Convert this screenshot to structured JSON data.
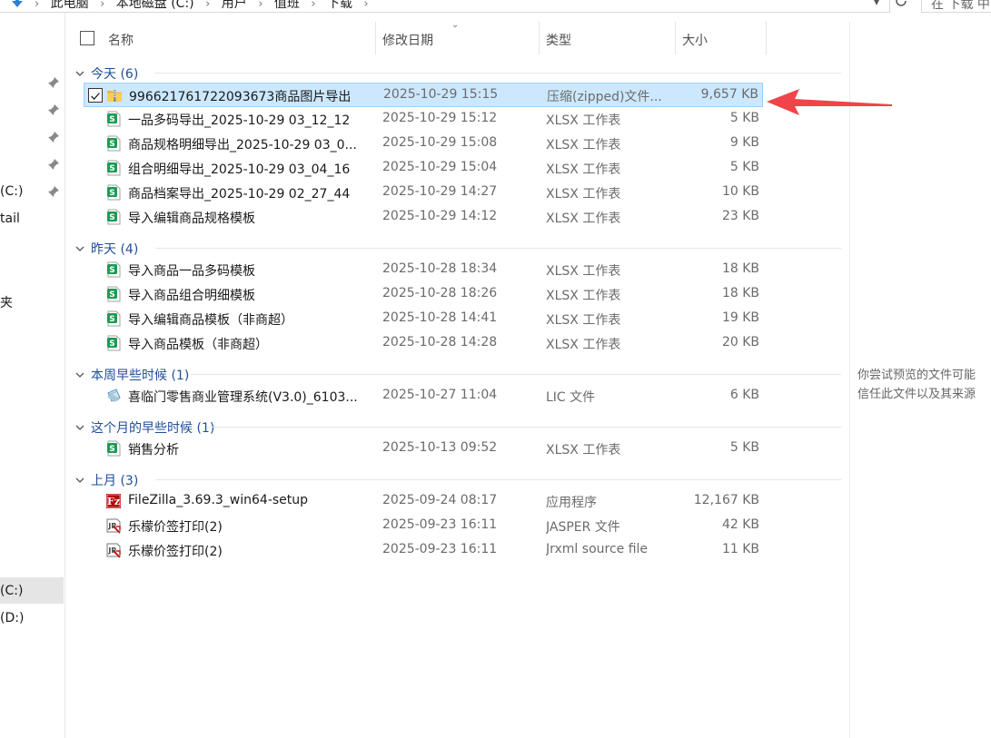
{
  "address_bar": {
    "crumbs": [
      "此电脑",
      "本地磁盘 (C:)",
      "用户",
      "值班",
      "下载"
    ],
    "search_placeholder": "在 下载 中"
  },
  "nav_pane": {
    "labels": [
      "(C:)",
      "tail",
      "夹",
      "(C:)",
      "(D:)"
    ]
  },
  "columns": {
    "name": "名称",
    "date": "修改日期",
    "type": "类型",
    "size": "大小"
  },
  "groups": [
    {
      "title": "今天 (6)",
      "files": [
        {
          "name": "996621761722093673商品图片导出",
          "date": "2025-10-29 15:15",
          "type": "压缩(zipped)文件...",
          "size": "9,657 KB",
          "icon": "zip-folder-icon",
          "selected": true
        },
        {
          "name": "一品多码导出_2025-10-29 03_12_12",
          "date": "2025-10-29 15:12",
          "type": "XLSX 工作表",
          "size": "5 KB",
          "icon": "xlsx-icon"
        },
        {
          "name": "商品规格明细导出_2025-10-29 03_0...",
          "date": "2025-10-29 15:08",
          "type": "XLSX 工作表",
          "size": "9 KB",
          "icon": "xlsx-icon"
        },
        {
          "name": "组合明细导出_2025-10-29 03_04_16",
          "date": "2025-10-29 15:04",
          "type": "XLSX 工作表",
          "size": "5 KB",
          "icon": "xlsx-icon"
        },
        {
          "name": "商品档案导出_2025-10-29 02_27_44",
          "date": "2025-10-29 14:27",
          "type": "XLSX 工作表",
          "size": "10 KB",
          "icon": "xlsx-icon"
        },
        {
          "name": "导入编辑商品规格模板",
          "date": "2025-10-29 14:12",
          "type": "XLSX 工作表",
          "size": "23 KB",
          "icon": "xlsx-icon"
        }
      ]
    },
    {
      "title": "昨天 (4)",
      "files": [
        {
          "name": "导入商品一品多码模板",
          "date": "2025-10-28 18:34",
          "type": "XLSX 工作表",
          "size": "18 KB",
          "icon": "xlsx-icon"
        },
        {
          "name": "导入商品组合明细模板",
          "date": "2025-10-28 18:26",
          "type": "XLSX 工作表",
          "size": "18 KB",
          "icon": "xlsx-icon"
        },
        {
          "name": "导入编辑商品模板（非商超）",
          "date": "2025-10-28 14:41",
          "type": "XLSX 工作表",
          "size": "19 KB",
          "icon": "xlsx-icon"
        },
        {
          "name": "导入商品模板（非商超）",
          "date": "2025-10-28 14:28",
          "type": "XLSX 工作表",
          "size": "20 KB",
          "icon": "xlsx-icon"
        }
      ]
    },
    {
      "title": "本周早些时候 (1)",
      "files": [
        {
          "name": "喜临门零售商业管理系统(V3.0)_6103...",
          "date": "2025-10-27 11:04",
          "type": "LIC 文件",
          "size": "6 KB",
          "icon": "lic-file-icon"
        }
      ]
    },
    {
      "title": "这个月的早些时候 (1)",
      "files": [
        {
          "name": "销售分析",
          "date": "2025-10-13 09:52",
          "type": "XLSX 工作表",
          "size": "5 KB",
          "icon": "xlsx-icon"
        }
      ]
    },
    {
      "title": "上月 (3)",
      "files": [
        {
          "name": "FileZilla_3.69.3_win64-setup",
          "date": "2025-09-24 08:17",
          "type": "应用程序",
          "size": "12,167 KB",
          "icon": "filezilla-icon"
        },
        {
          "name": "乐檬价签打印(2)",
          "date": "2025-09-23 16:11",
          "type": "JASPER 文件",
          "size": "42 KB",
          "icon": "jasper-report-icon"
        },
        {
          "name": "乐檬价签打印(2)",
          "date": "2025-09-23 16:11",
          "type": "Jrxml source file",
          "size": "11 KB",
          "icon": "jasper-report-icon"
        }
      ]
    }
  ],
  "preview": {
    "message_line1": "你尝试预览的文件可能",
    "message_line2": "信任此文件以及其来源"
  },
  "colors": {
    "group_title": "#1f4e99",
    "selection_bg": "#cce8ff",
    "selection_border": "#99d1ff",
    "xlsx_green": "#1d9b54",
    "annotation_arrow": "#f0444a"
  }
}
